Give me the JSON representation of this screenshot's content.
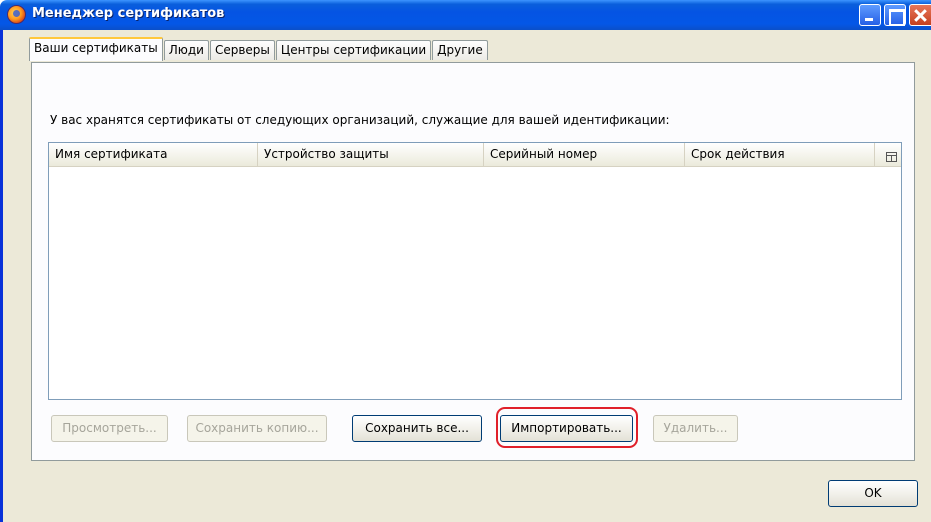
{
  "window": {
    "title": "Менеджер сертификатов",
    "icon": "firefox-icon"
  },
  "tabs": [
    {
      "label": "Ваши сертификаты",
      "active": true
    },
    {
      "label": "Люди",
      "active": false
    },
    {
      "label": "Серверы",
      "active": false
    },
    {
      "label": "Центры сертификации",
      "active": false
    },
    {
      "label": "Другие",
      "active": false
    }
  ],
  "panel": {
    "description": "У вас хранятся сертификаты от следующих организаций, служащие для вашей идентификации:",
    "columns": [
      "Имя сертификата",
      "Устройство защиты",
      "Серийный номер",
      "Срок действия"
    ],
    "column_picker_icon": "column-picker-icon",
    "rows": []
  },
  "buttons": {
    "view": "Просмотреть...",
    "save_copy": "Сохранить копию...",
    "save_all": "Сохранить все...",
    "import": "Импортировать...",
    "delete": "Удалить...",
    "ok": "OK"
  },
  "colors": {
    "titlebar": "#0554e3",
    "highlight": "#e0202a",
    "face": "#ece9d8"
  }
}
